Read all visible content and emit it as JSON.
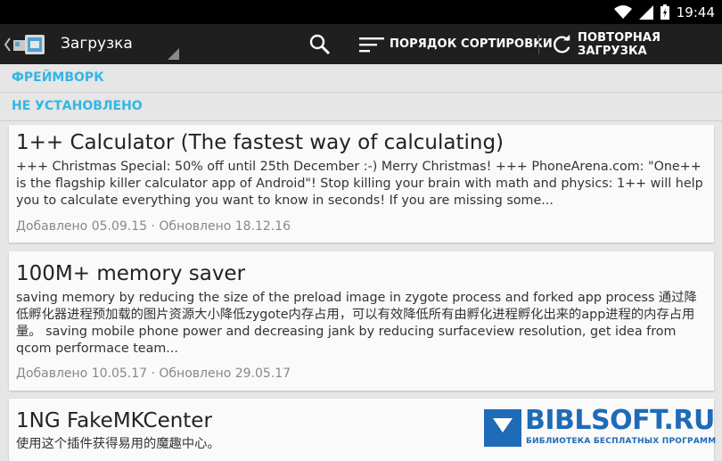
{
  "status_bar": {
    "time": "19:44",
    "icons": [
      "wifi-icon",
      "signal-icon",
      "battery-icon"
    ]
  },
  "action_bar": {
    "title": "Загрузка",
    "sort_label": "ПОРЯДОК СОРТИРОВКИ",
    "reload_label": "ПОВТОРНАЯ ЗАГРУЗКА",
    "icons": [
      "xposed-up-icon",
      "search-icon",
      "sort-icon",
      "reload-icon"
    ]
  },
  "sections": {
    "framework": "ФРЕЙМВОРК",
    "not_installed": "НЕ УСТАНОВЛЕНО"
  },
  "modules": [
    {
      "title": "1++ Calculator (The fastest way of calculating)",
      "description": "+++ Christmas Special: 50% off until 25th December :-) Merry Christmas! +++ PhoneArena.com: \"One++ is the flagship killer calculator app of Android\"! Stop killing your brain with math and physics: 1++ will help you to calculate everything you want to know in seconds! If you are missing some...",
      "meta": "Добавлено 05.09.15 · Обновлено 18.12.16"
    },
    {
      "title": "100M+ memory saver",
      "description": "saving memory by reducing the size of the preload image in zygote process and forked app process 通过降低孵化器进程预加载的图片资源大小降低zygote内存占用，可以有效降低所有由孵化进程孵化出来的app进程的内存占用量。 saving mobile phone power and decreasing jank by reducing surfaceview resolution, get idea from qcom performace team...",
      "meta": "Добавлено 10.05.17 · Обновлено 29.05.17"
    },
    {
      "title": "1NG FakeMKCenter",
      "description": "使用这个插件获得易用的魔趣中心。",
      "meta": ""
    }
  ],
  "watermark": {
    "text": "BIBLSOFT.RU",
    "subtitle": "БИБЛИОТЕКА БЕСПЛАТНЫХ ПРОГРАММ",
    "color": "#1e6bb8"
  },
  "colors": {
    "accent": "#33b5e5",
    "actionbar": "#1f1f1f",
    "background": "#e6e6e6",
    "card": "#fafafa"
  }
}
